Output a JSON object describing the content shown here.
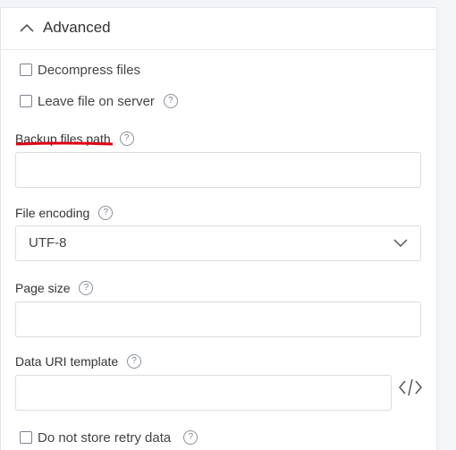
{
  "section": {
    "title": "Advanced"
  },
  "checkboxes": {
    "decompress": "Decompress files",
    "leave_on_server": "Leave file on server",
    "no_retry": "Do not store retry data"
  },
  "fields": {
    "backup_path": {
      "label": "Backup files path",
      "value": ""
    },
    "encoding": {
      "label": "File encoding",
      "selected": "UTF-8"
    },
    "page_size": {
      "label": "Page size",
      "value": ""
    },
    "data_uri": {
      "label": "Data URI template",
      "value": ""
    }
  },
  "help_glyph": "?",
  "annotation": {
    "underline_color": "#e0001a"
  }
}
